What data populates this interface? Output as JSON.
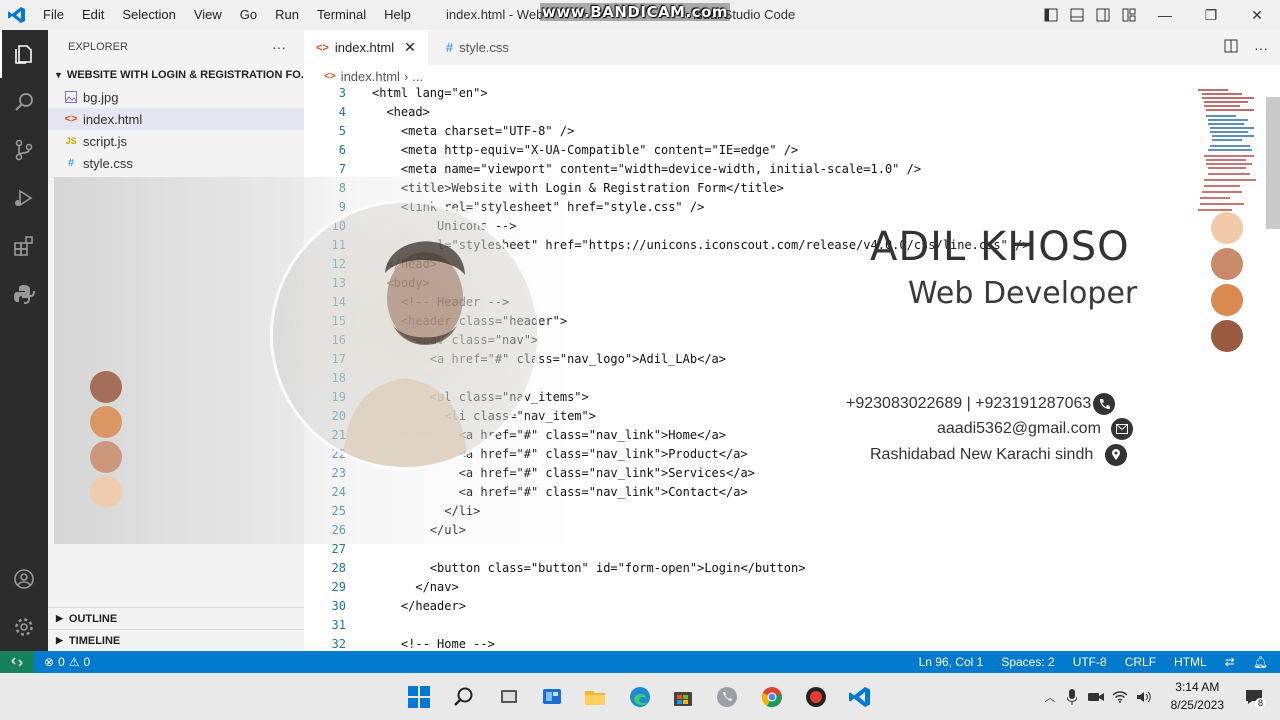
{
  "titlebar": {
    "menu": [
      "File",
      "Edit",
      "Selection",
      "View",
      "Go",
      "Run",
      "Terminal",
      "Help"
    ],
    "title": "index.html - Web",
    "title_suffix": "isual Studio Code",
    "watermark": "www.BANDICAM.com"
  },
  "sidebar": {
    "header": "EXPLORER",
    "more": "···",
    "folder": "WEBSITE WITH LOGIN & REGISTRATION FO...",
    "files": [
      {
        "name": "bg.jpg",
        "icon": "image-file-icon"
      },
      {
        "name": "index.html",
        "icon": "html-file-icon"
      },
      {
        "name": "script.js",
        "icon": "js-file-icon"
      },
      {
        "name": "style.css",
        "icon": "css-file-icon"
      }
    ],
    "outline": "OUTLINE",
    "timeline": "TIMELINE"
  },
  "tabs": [
    {
      "label": "index.html",
      "active": true
    },
    {
      "label": "style.css",
      "active": false
    }
  ],
  "breadcrumb": {
    "file": "index.html",
    "rest": "..."
  },
  "code_lines": [
    {
      "n": "3",
      "text": "<html lang=\"en\">"
    },
    {
      "n": "4",
      "text": "  <head>"
    },
    {
      "n": "5",
      "text": "    <meta charset=\"UTF-8\" />"
    },
    {
      "n": "6",
      "text": "    <meta http-equiv=\"X-UA-Compatible\" content=\"IE=edge\" />"
    },
    {
      "n": "7",
      "text": "    <meta name=\"viewport\" content=\"width=device-width, initial-scale=1.0\" />"
    },
    {
      "n": "8",
      "text": "    <title>Website with Login & Registration Form</title>"
    },
    {
      "n": "9",
      "text": "    <link rel=\"stylesheet\" href=\"style.css\" />"
    },
    {
      "n": "10",
      "text": "         Unicons -->"
    },
    {
      "n": "11",
      "text": "         l=\"stylesheet\" href=\"https://unicons.iconscout.com/release/v4.0.0/css/line.css\" />"
    },
    {
      "n": "12",
      "text": "  </head>"
    },
    {
      "n": "13",
      "text": "  <body>"
    },
    {
      "n": "14",
      "text": "    <!-- Header -->"
    },
    {
      "n": "15",
      "text": "    <header class=\"header\">"
    },
    {
      "n": "16",
      "text": "      <nav class=\"nav\">"
    },
    {
      "n": "17",
      "text": "        <a href=\"#\" class=\"nav_logo\">Adil_LAb</a>"
    },
    {
      "n": "18",
      "text": ""
    },
    {
      "n": "19",
      "text": "        <ul class=\"nav_items\">"
    },
    {
      "n": "20",
      "text": "          <li class=\"nav_item\">"
    },
    {
      "n": "21",
      "text": "            <a href=\"#\" class=\"nav_link\">Home</a>"
    },
    {
      "n": "22",
      "text": "            <a href=\"#\" class=\"nav_link\">Product</a>"
    },
    {
      "n": "23",
      "text": "            <a href=\"#\" class=\"nav_link\">Services</a>"
    },
    {
      "n": "24",
      "text": "            <a href=\"#\" class=\"nav_link\">Contact</a>"
    },
    {
      "n": "25",
      "text": "          </li>"
    },
    {
      "n": "26",
      "text": "        </ul>"
    },
    {
      "n": "27",
      "text": ""
    },
    {
      "n": "28",
      "text": "        <button class=\"button\" id=\"form-open\">Login</button>"
    },
    {
      "n": "29",
      "text": "      </nav>"
    },
    {
      "n": "30",
      "text": "    </header>"
    },
    {
      "n": "31",
      "text": ""
    },
    {
      "n": "32",
      "text": "    <!-- Home -->"
    }
  ],
  "overlay": {
    "name": "ADIL KHOSO",
    "role": "Web Developer",
    "phone": "+923083022689 | +923191287063",
    "email": "aaadi5362@gmail.com",
    "address": "Rashidabad New Karachi sindh",
    "palette": [
      "#f2c9a6",
      "#c98b6a",
      "#d98a4e",
      "#9a5a42"
    ],
    "palette_left": [
      "#9a5a42",
      "#d98a4e",
      "#c98b6a",
      "#f2c9a6"
    ]
  },
  "statusbar": {
    "errors": "0",
    "warnings": "0",
    "position": "Ln 96, Col 1",
    "spaces": "Spaces: 2",
    "encoding": "UTF-8",
    "eol": "CRLF",
    "language": "HTML"
  },
  "taskbar": {
    "time": "3:14 AM",
    "date": "8/25/2023",
    "notification_count": "8"
  }
}
